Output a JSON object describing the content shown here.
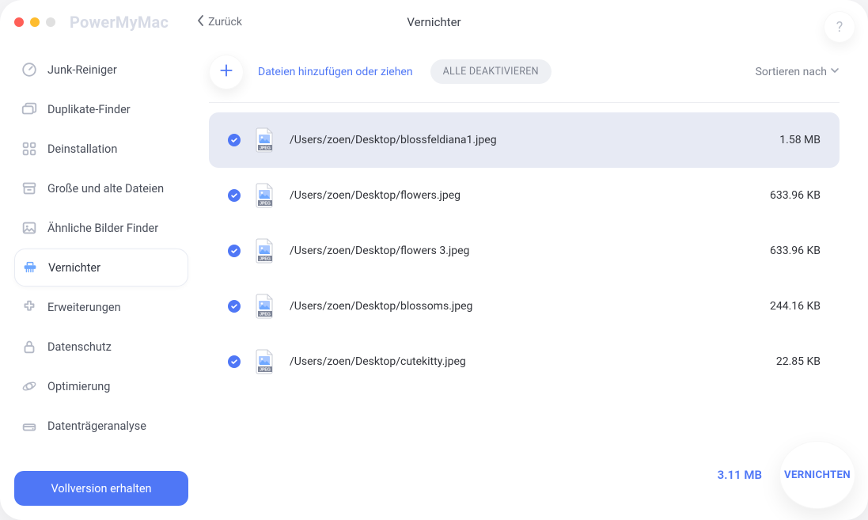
{
  "app": {
    "title": "PowerMyMac",
    "back_label": "Zurück",
    "page_title": "Vernichter",
    "help_label": "?"
  },
  "sidebar": {
    "items": [
      {
        "label": "Junk-Reiniger",
        "icon": "gauge-icon",
        "active": false
      },
      {
        "label": "Duplikate-Finder",
        "icon": "folders-icon",
        "active": false
      },
      {
        "label": "Deinstallation",
        "icon": "grid-icon",
        "active": false
      },
      {
        "label": "Große und alte Dateien",
        "icon": "archive-icon",
        "active": false
      },
      {
        "label": "Ähnliche Bilder Finder",
        "icon": "image-icon",
        "active": false
      },
      {
        "label": "Vernichter",
        "icon": "shredder-icon",
        "active": true
      },
      {
        "label": "Erweiterungen",
        "icon": "extension-icon",
        "active": false
      },
      {
        "label": "Datenschutz",
        "icon": "lock-icon",
        "active": false
      },
      {
        "label": "Optimierung",
        "icon": "orbit-icon",
        "active": false
      },
      {
        "label": "Datenträgeranalyse",
        "icon": "disk-icon",
        "active": false
      }
    ],
    "full_version_label": "Vollversion erhalten"
  },
  "toolbar": {
    "add_label": "Dateien hinzufügen oder ziehen",
    "toggle_all_label": "ALLE DEAKTIVIEREN",
    "sort_label": "Sortieren nach"
  },
  "files": [
    {
      "path": "/Users/zoen/Desktop/blossfeldiana1.jpeg",
      "size": "1.58 MB",
      "checked": true,
      "selected": true
    },
    {
      "path": "/Users/zoen/Desktop/flowers.jpeg",
      "size": "633.96 KB",
      "checked": true,
      "selected": false
    },
    {
      "path": "/Users/zoen/Desktop/flowers 3.jpeg",
      "size": "633.96 KB",
      "checked": true,
      "selected": false
    },
    {
      "path": "/Users/zoen/Desktop/blossoms.jpeg",
      "size": "244.16 KB",
      "checked": true,
      "selected": false
    },
    {
      "path": "/Users/zoen/Desktop/cutekitty.jpeg",
      "size": "22.85 KB",
      "checked": true,
      "selected": false
    }
  ],
  "footer": {
    "total_size": "3.11 MB",
    "action_label": "VERNICHTEN"
  }
}
